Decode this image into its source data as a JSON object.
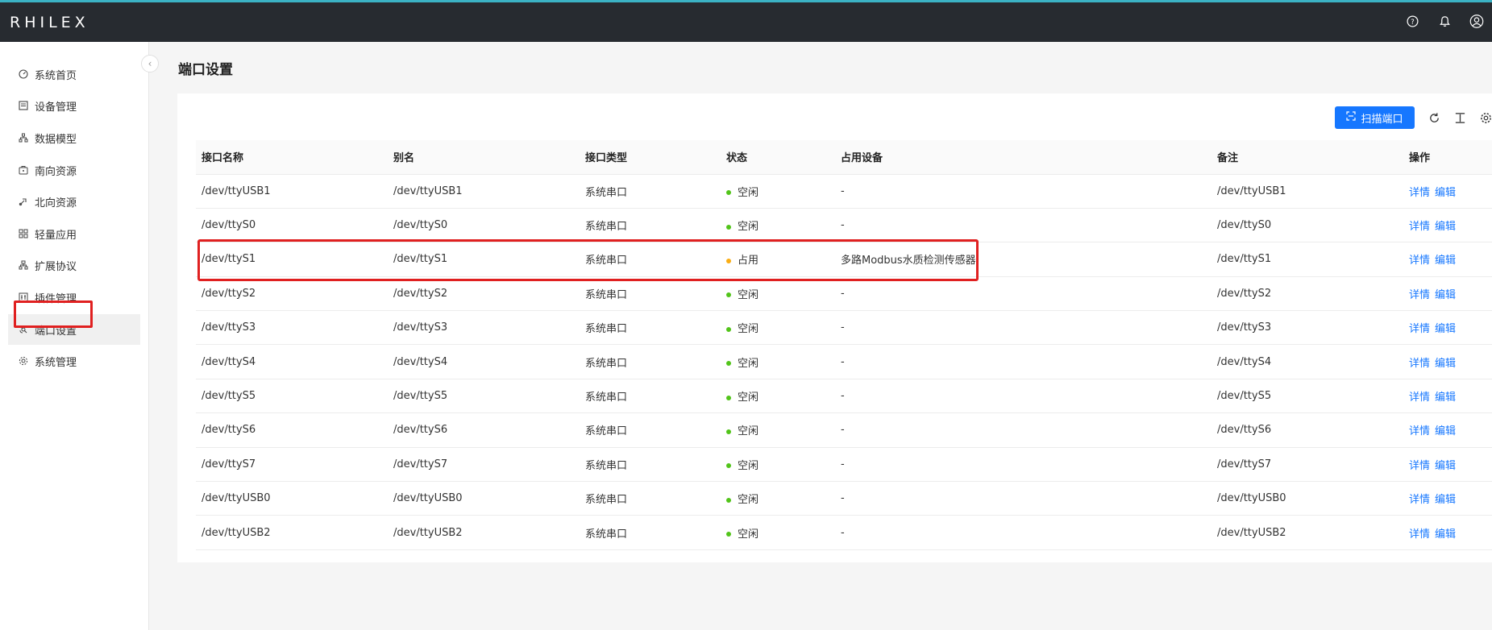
{
  "brand": "RHILEX",
  "topbar": {
    "icons": [
      "help-icon",
      "bell-icon",
      "user-icon"
    ]
  },
  "sidebar": {
    "items": [
      {
        "label": "系统首页",
        "icon": "dashboard-icon"
      },
      {
        "label": "设备管理",
        "icon": "device-icon"
      },
      {
        "label": "数据模型",
        "icon": "model-icon"
      },
      {
        "label": "南向资源",
        "icon": "south-icon"
      },
      {
        "label": "北向资源",
        "icon": "north-icon"
      },
      {
        "label": "轻量应用",
        "icon": "app-icon"
      },
      {
        "label": "扩展协议",
        "icon": "protocol-icon"
      },
      {
        "label": "插件管理",
        "icon": "plugin-icon"
      },
      {
        "label": "端口设置",
        "icon": "port-icon",
        "active": true
      },
      {
        "label": "系统管理",
        "icon": "gear-icon"
      }
    ]
  },
  "page": {
    "title": "端口设置"
  },
  "toolbar": {
    "scan_label": "扫描端口"
  },
  "table": {
    "headers": [
      "接口名称",
      "别名",
      "接口类型",
      "状态",
      "占用设备",
      "备注",
      "操作"
    ],
    "rows": [
      {
        "name": "/dev/ttyUSB1",
        "alias": "/dev/ttyUSB1",
        "type": "系统串口",
        "status": "空闲",
        "device": "-",
        "remark": "/dev/ttyUSB1"
      },
      {
        "name": "/dev/ttyS0",
        "alias": "/dev/ttyS0",
        "type": "系统串口",
        "status": "空闲",
        "device": "-",
        "remark": "/dev/ttyS0"
      },
      {
        "name": "/dev/ttyS1",
        "alias": "/dev/ttyS1",
        "type": "系统串口",
        "status": "占用",
        "device": "多路Modbus水质检测传感器",
        "remark": "/dev/ttyS1"
      },
      {
        "name": "/dev/ttyS2",
        "alias": "/dev/ttyS2",
        "type": "系统串口",
        "status": "空闲",
        "device": "-",
        "remark": "/dev/ttyS2"
      },
      {
        "name": "/dev/ttyS3",
        "alias": "/dev/ttyS3",
        "type": "系统串口",
        "status": "空闲",
        "device": "-",
        "remark": "/dev/ttyS3"
      },
      {
        "name": "/dev/ttyS4",
        "alias": "/dev/ttyS4",
        "type": "系统串口",
        "status": "空闲",
        "device": "-",
        "remark": "/dev/ttyS4"
      },
      {
        "name": "/dev/ttyS5",
        "alias": "/dev/ttyS5",
        "type": "系统串口",
        "status": "空闲",
        "device": "-",
        "remark": "/dev/ttyS5"
      },
      {
        "name": "/dev/ttyS6",
        "alias": "/dev/ttyS6",
        "type": "系统串口",
        "status": "空闲",
        "device": "-",
        "remark": "/dev/ttyS6"
      },
      {
        "name": "/dev/ttyS7",
        "alias": "/dev/ttyS7",
        "type": "系统串口",
        "status": "空闲",
        "device": "-",
        "remark": "/dev/ttyS7"
      },
      {
        "name": "/dev/ttyUSB0",
        "alias": "/dev/ttyUSB0",
        "type": "系统串口",
        "status": "空闲",
        "device": "-",
        "remark": "/dev/ttyUSB0"
      },
      {
        "name": "/dev/ttyUSB2",
        "alias": "/dev/ttyUSB2",
        "type": "系统串口",
        "status": "空闲",
        "device": "-",
        "remark": "/dev/ttyUSB2"
      }
    ],
    "actions": {
      "detail": "详情",
      "edit": "编辑"
    }
  },
  "colors": {
    "idle": "#52c41a",
    "busy": "#faad14",
    "link": "#1677ff",
    "highlight": "#e02020"
  }
}
